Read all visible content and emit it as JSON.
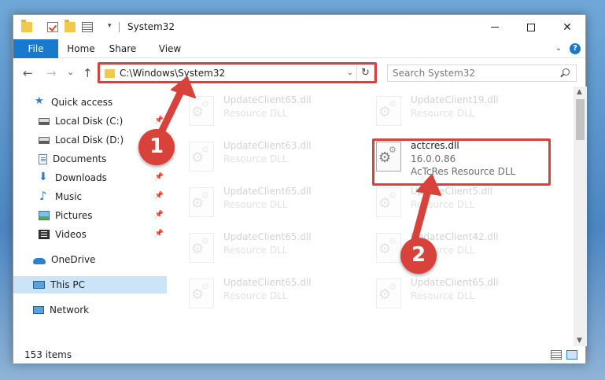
{
  "window": {
    "title": "System32",
    "minimize_glyph": "",
    "maximize_glyph": "",
    "close_glyph": "✕"
  },
  "ribbon": {
    "tabs": [
      {
        "label": "File"
      },
      {
        "label": "Home"
      },
      {
        "label": "Share"
      },
      {
        "label": "View"
      }
    ],
    "help_glyph": "?"
  },
  "nav": {
    "back_glyph": "←",
    "forward_glyph": "→",
    "recent_glyph": "⌄",
    "up_glyph": "↑",
    "address": "C:\\Windows\\System32",
    "search_placeholder": "Search System32"
  },
  "sidebar": {
    "items": [
      {
        "label": "Quick access",
        "icon": "star-icon"
      },
      {
        "label": "Local Disk (C:)",
        "icon": "drive-icon",
        "pinned": true
      },
      {
        "label": "Local Disk (D:)",
        "icon": "drive-icon",
        "pinned": true
      },
      {
        "label": "Documents",
        "icon": "documents-icon",
        "pinned": true
      },
      {
        "label": "Downloads",
        "icon": "downloads-icon",
        "pinned": true
      },
      {
        "label": "Music",
        "icon": "music-icon",
        "pinned": true
      },
      {
        "label": "Pictures",
        "icon": "pictures-icon",
        "pinned": true
      },
      {
        "label": "Videos",
        "icon": "videos-icon",
        "pinned": true
      },
      {
        "label": "OneDrive",
        "icon": "onedrive-icon"
      },
      {
        "label": "This PC",
        "icon": "this-pc-icon",
        "selected": true
      },
      {
        "label": "Network",
        "icon": "network-icon"
      }
    ]
  },
  "files": [
    {
      "name": "UpdateClient65.dll",
      "type": "Resource DLL",
      "faded": true
    },
    {
      "name": "UpdateClient19.dll",
      "type": "Resource DLL",
      "faded": true
    },
    {
      "name": "UpdateClient63.dll",
      "type": "Resource DLL",
      "faded": true
    },
    {
      "name": "actcres.dll",
      "version": "16.0.0.86",
      "type": "AcTcRes Resource DLL",
      "faded": false
    },
    {
      "name": "UpdateClient65.dll",
      "type": "Resource DLL",
      "faded": true
    },
    {
      "name": "UpdateClient5.dll",
      "type": "Resource DLL",
      "faded": true
    },
    {
      "name": "UpdateClient65.dll",
      "type": "Resource DLL",
      "faded": true
    },
    {
      "name": "UpdateClient42.dll",
      "type": "Resource DLL",
      "faded": true
    },
    {
      "name": "UpdateClient65.dll",
      "type": "Resource DLL",
      "faded": true
    },
    {
      "name": "UpdateClient65.dll",
      "type": "Resource DLL",
      "faded": true
    }
  ],
  "status": {
    "item_count": "153 items"
  },
  "annotations": {
    "step1": "1",
    "step2": "2",
    "color": "#d9413b"
  },
  "colors": {
    "accent": "#1979ca",
    "selection": "#cce4f7"
  }
}
